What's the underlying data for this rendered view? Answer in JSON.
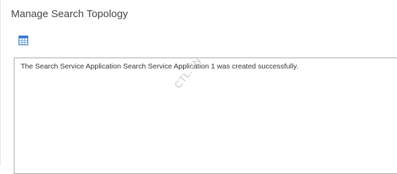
{
  "page": {
    "title": "Manage Search Topology"
  },
  "toolbar": {
    "icon": "grid-table-icon"
  },
  "message": {
    "text": "The Search Service Application Search Service Application 1 was created successfully."
  },
  "watermark": {
    "text": "CTL.VN"
  },
  "colors": {
    "title": "#444444",
    "icon_blue": "#2b6cb0",
    "border": "#a8a8a8"
  }
}
